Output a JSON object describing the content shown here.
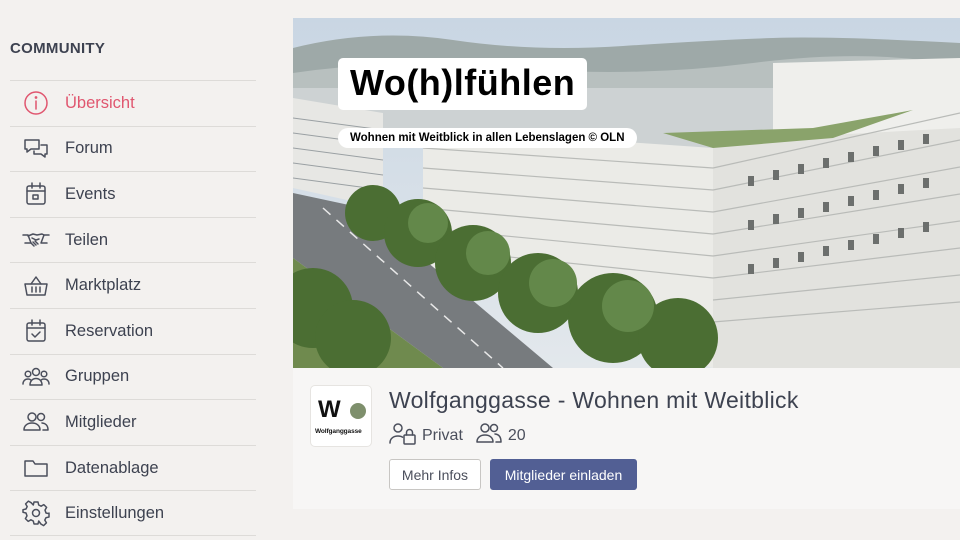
{
  "sidebar": {
    "title": "COMMUNITY",
    "items": [
      {
        "label": "Übersicht",
        "icon": "info-circle-icon",
        "active": true
      },
      {
        "label": "Forum",
        "icon": "chat-bubbles-icon"
      },
      {
        "label": "Events",
        "icon": "calendar-icon"
      },
      {
        "label": "Teilen",
        "icon": "handshake-icon"
      },
      {
        "label": "Marktplatz",
        "icon": "basket-icon"
      },
      {
        "label": "Reservation",
        "icon": "calendar-check-icon"
      },
      {
        "label": "Gruppen",
        "icon": "groups-icon"
      },
      {
        "label": "Mitglieder",
        "icon": "members-icon"
      },
      {
        "label": "Datenablage",
        "icon": "folder-icon"
      },
      {
        "label": "Einstellungen",
        "icon": "gear-icon"
      }
    ]
  },
  "hero": {
    "title": "Wo(h)lfühlen",
    "subtitle": "Wohnen mit Weitblick in allen Lebenslagen © OLN"
  },
  "group": {
    "logo_letter": "W",
    "logo_text": "Wolfganggasse",
    "title": "Wolfganggasse - Wohnen mit Weitblick",
    "privacy": "Privat",
    "member_count": "20",
    "more_info_label": "Mehr Infos",
    "invite_label": "Mitglieder einladen"
  },
  "colors": {
    "accent_active": "#e0566f",
    "button_primary": "#525f94",
    "logo_dot": "#7e8f6c"
  }
}
